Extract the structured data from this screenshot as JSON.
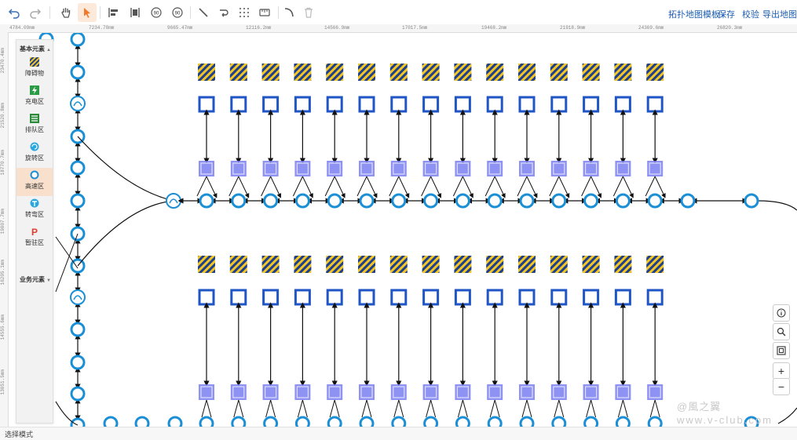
{
  "toolbar": {
    "undo": "undo-icon",
    "redo": "redo-icon",
    "pan": "hand-icon",
    "select": "pointer-icon",
    "align_left": "align-left-icon",
    "align_center": "align-center-icon",
    "rotate_ccw": "rotate-ccw-90-icon",
    "rotate_cw": "rotate-cw-90-icon",
    "line": "line-icon",
    "curve": "curve-icon",
    "grid": "grid-icon",
    "ruler": "ruler-icon",
    "arc": "arc-icon",
    "delete": "trash-icon",
    "rotate_ccw_label": "90",
    "rotate_cw_label": "90",
    "template_menu": "拓扑地图模板",
    "save": "保存",
    "validate": "校验",
    "export_menu": "导出地图",
    "accent_color": "#f07a2a",
    "link_color": "#1e5fb4"
  },
  "ruler": {
    "top": [
      "4784.09mm",
      "7234.78mm",
      "9665.47mm",
      "12116.2mm",
      "14566.9mm",
      "17017.5mm",
      "19468.2mm",
      "21918.9mm",
      "24369.6mm",
      "26820.3mm"
    ],
    "left": [
      "23470.4mm",
      "21520.8mm",
      "18770.7mm",
      "19007.7mm",
      "16205.1mm",
      "14555.6mm",
      "13051.5mm"
    ]
  },
  "palette": {
    "basic_section": "基本元素",
    "business_section": "业务元素",
    "items": [
      {
        "label": "障碍物",
        "icon": "obstacle-icon"
      },
      {
        "label": "充电区",
        "icon": "charging-icon"
      },
      {
        "label": "排队区",
        "icon": "queue-icon"
      },
      {
        "label": "旋转区",
        "icon": "rotation-icon"
      },
      {
        "label": "高速区",
        "icon": "highspeed-icon"
      },
      {
        "label": "转弯区",
        "icon": "turn-icon"
      },
      {
        "label": "暂驻区",
        "icon": "parking-icon"
      }
    ],
    "selected_index": 4
  },
  "zoom": {
    "info": "info-icon",
    "search": "search-icon",
    "fit": "fit-screen-icon",
    "zoom_in": "+",
    "zoom_out": "−"
  },
  "status": {
    "mode": "选择模式"
  },
  "watermark": {
    "line1": "@風之翼",
    "line2": "www.v-club.com"
  },
  "colors": {
    "node_blue": "#1a8fd6",
    "station_blue": "#1f55c4",
    "stripe_yellow": "#f3c623",
    "stripe_navy": "#1d3f8f",
    "path_black": "#111111",
    "qr_purple": "#7a7ff0"
  }
}
